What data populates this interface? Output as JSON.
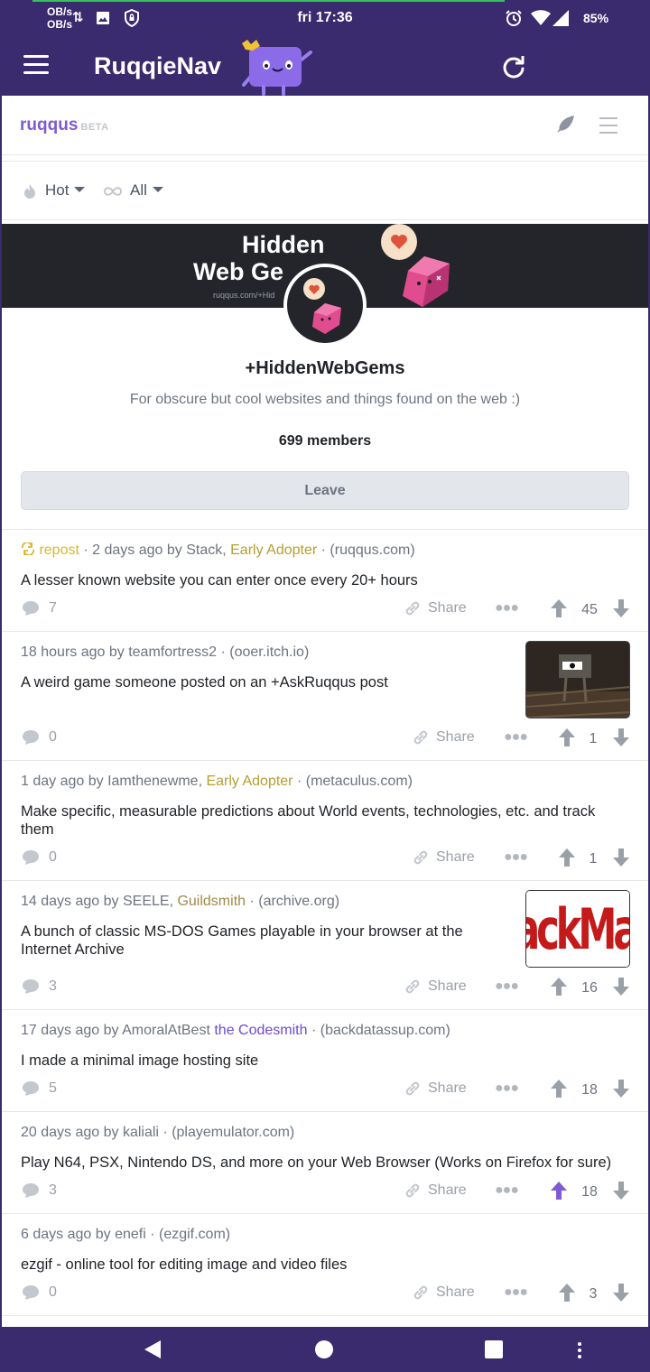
{
  "status_bar": {
    "net_speed_up": "OB/s",
    "net_speed_down": "OB/s",
    "time": "fri 17:36",
    "battery": "85%"
  },
  "app_bar": {
    "title": "RuqqieNav"
  },
  "site": {
    "logo": "ruqqus",
    "beta": "BETA"
  },
  "sort": {
    "sort_label": "Hot",
    "filter_label": "All"
  },
  "guild": {
    "banner_line1": "Hidden",
    "banner_line2": "Web Ge",
    "banner_url": "ruqqus.com/+Hid",
    "name": "+HiddenWebGems",
    "description": "For obscure but cool websites and things found on the web :)",
    "members": "699 members",
    "leave_label": "Leave"
  },
  "posts": [
    {
      "repost": "repost",
      "meta_prefix": " · 2 days ago by Stack, ",
      "flair": "Early Adopter",
      "domain": " · (ruqqus.com)",
      "title": "A lesser known website you can enter once every 20+ hours",
      "comments": "7",
      "share": "Share",
      "score": "45"
    },
    {
      "meta_prefix": "18 hours ago by teamfortress2",
      "domain": " · (ooer.itch.io)",
      "title": "A weird game someone posted on an +AskRuqqus post",
      "comments": "0",
      "share": "Share",
      "score": "1"
    },
    {
      "meta_prefix": "1 day ago by Iamthenewme, ",
      "flair": "Early Adopter",
      "domain": " · (metaculus.com)",
      "title": "Make specific, measurable predictions about World events, technologies, etc. and track them",
      "comments": "0",
      "share": "Share",
      "score": "1"
    },
    {
      "meta_prefix": "14 days ago by SEELE, ",
      "flair": "Guildsmith",
      "domain": " · (archive.org)",
      "title": "A bunch of classic MS-DOS Games playable in your browser at the Internet Archive",
      "comments": "3",
      "share": "Share",
      "score": "16",
      "thumb_text": "ackMa"
    },
    {
      "meta_prefix": "17 days ago by AmoralAtBest ",
      "flair": "the Codesmith",
      "domain": " · (backdatassup.com)",
      "title": "I made a minimal image hosting site",
      "comments": "5",
      "share": "Share",
      "score": "18"
    },
    {
      "meta_prefix": "20 days ago by kaliali",
      "domain": " · (playemulator.com)",
      "title": "Play N64, PSX, Nintendo DS, and more on your Web Browser (Works on Firefox for sure)",
      "comments": "3",
      "share": "Share",
      "score": "18"
    },
    {
      "meta_prefix": "6 days ago by enefi",
      "domain": " · (ezgif.com)",
      "title": "ezgif - online tool for editing image and video files",
      "comments": "0",
      "share": "Share",
      "score": "3"
    }
  ],
  "colors": {
    "primary": "#3a2a6e",
    "accent": "#805ad5",
    "upvoted": "#805ad5",
    "repost": "#d9b72d",
    "flair_gold": "#b59e2f"
  }
}
